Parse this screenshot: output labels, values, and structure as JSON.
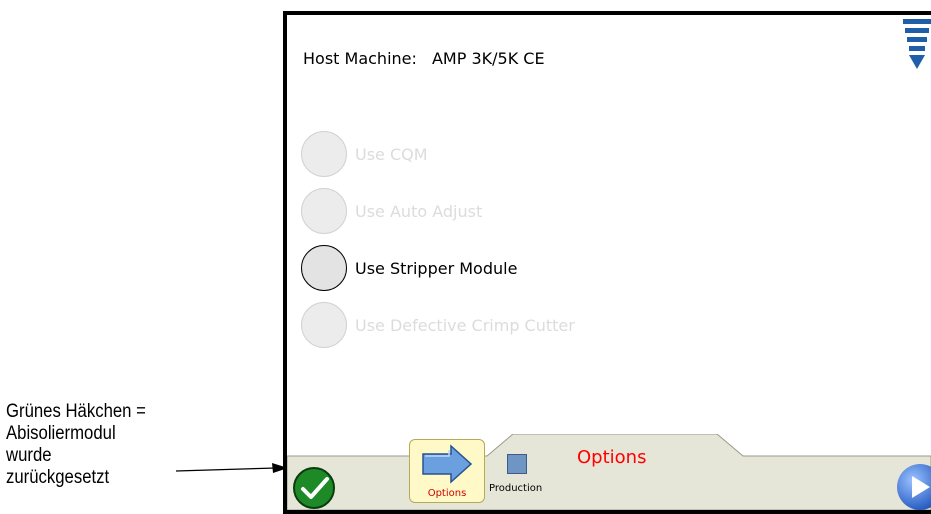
{
  "annotation": {
    "lines": [
      "Grünes Häkchen =",
      "Abisoliermodul",
      "wurde",
      "zurückgesetzt"
    ]
  },
  "header": {
    "host_label": "Host Machine:",
    "host_value": "AMP 3K/5K CE",
    "menu_icon": "menu-triangle-icon"
  },
  "options": [
    {
      "label": "Use CQM",
      "enabled": false
    },
    {
      "label": "Use Auto Adjust",
      "enabled": false
    },
    {
      "label": "Use Stripper Module",
      "enabled": true
    },
    {
      "label": "Use Defective Crimp Cutter",
      "enabled": false
    }
  ],
  "toolbar": {
    "tab_title": "Options",
    "options_label": "Options",
    "production_label": "Production",
    "ok_icon": "green-checkmark-icon",
    "next_icon": "next-arrow-icon"
  },
  "colors": {
    "tab_title": "#ff0000",
    "ok_button": "#1d8a27",
    "options_button_bg": "#fff9c8",
    "toolbar_bg": "#e6e6d8",
    "menu_icon": "#1f5ea8"
  }
}
